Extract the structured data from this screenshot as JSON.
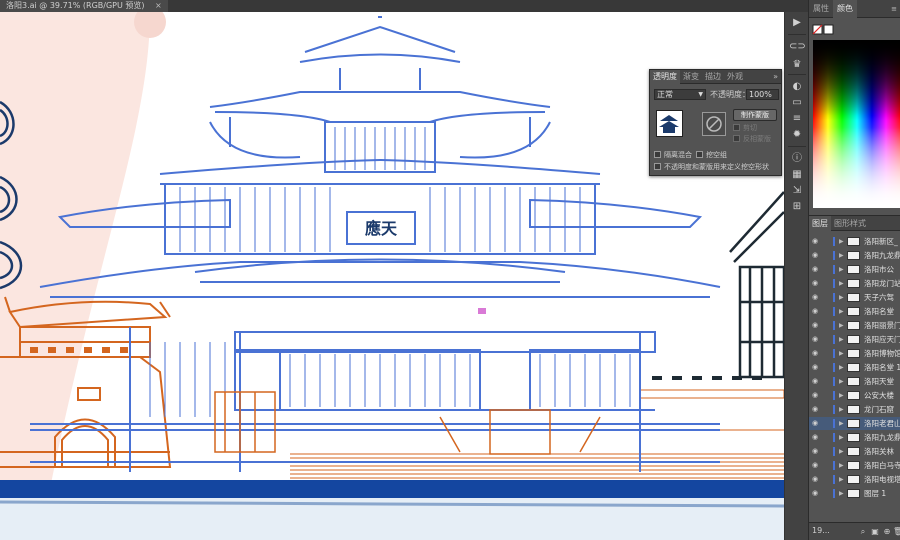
{
  "document_tab": {
    "title": "洛阳3.ai @ 39.71% (RGB/GPU 预览)",
    "close": "×"
  },
  "artwork": {
    "plaque_text": "應天"
  },
  "transparency_panel": {
    "tabs": [
      "透明度",
      "渐变",
      "描边",
      "外观"
    ],
    "more": "»",
    "blend_mode": "正常",
    "opacity_label": "不透明度：",
    "opacity_value": "100%",
    "make_mask": "制作蒙版",
    "clip": "剪切",
    "invert_mask": "反相蒙版",
    "isolate_blending": "隔离混合",
    "knockout_group": "挖空组",
    "opacity_mask_define_knockout": "不透明度和蒙版用来定义挖空形状"
  },
  "color_panel": {
    "tabs": [
      "属性",
      "颜色"
    ],
    "more": "≡"
  },
  "layers_panel": {
    "tabs": [
      "图层",
      "图形样式"
    ],
    "layers": [
      "洛阳新区_",
      "洛阳九龙鼎",
      "洛阳市公",
      "洛阳龙门站",
      "天子六驾",
      "洛阳名堂",
      "洛阳丽景门",
      "洛阳应天门",
      "洛阳博物馆",
      "洛阳名堂 1",
      "洛阳天堂",
      "公安大楼",
      "龙门石窟",
      "洛阳老君山",
      "洛阳九龙鼎",
      "洛阳关林",
      "洛阳白马寺",
      "洛阳电视塔",
      "图层 1"
    ],
    "selected_index": 13,
    "count": "19..."
  },
  "colors": {
    "accent_blue": "#4a72d4",
    "orange": "#d4661f",
    "navy": "#1b3a6b",
    "dark": "#1e2a33"
  }
}
